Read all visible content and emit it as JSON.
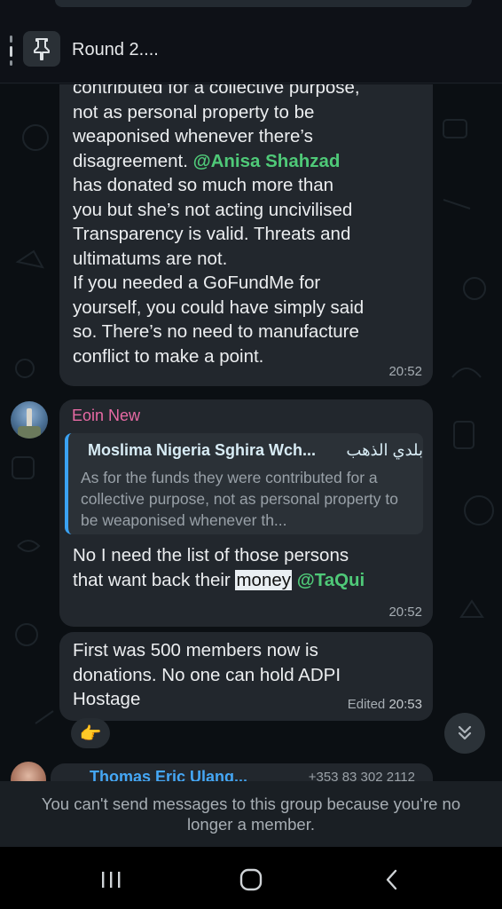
{
  "pinned": {
    "text": "Round 2...."
  },
  "messages": [
    {
      "lines": [
        "contributed for a collective purpose,",
        "not as personal property to be",
        "weaponised whenever there’s",
        "disagreement. "
      ],
      "mention": "@Anisa Shahzad",
      "rest": "\nhas donated so much more than\nyou but she’s not acting uncivilised\nTransparency is valid. Threats and\nultimatums are not.\nIf you needed a GoFundMe for\nyourself, you could have simply said\nso. There’s no need to manufacture\nconflict to make a point.",
      "time": "20:52"
    },
    {
      "sender": "Eoin New",
      "quote": {
        "name": "Moslima Nigeria Sghira Wch...",
        "name_ar": "بلدي الذهب",
        "text": "As for the funds they were contributed for a collective purpose, not as personal property to be weaponised whenever th..."
      },
      "text_before": "No I need the list of those persons\nthat want back their ",
      "highlight": "money",
      "mention": "@TaQui",
      "time": "20:52"
    },
    {
      "text": "First was 500 members now is\ndonations. No one can hold ADPI\nHostage",
      "edited_label": "Edited",
      "time": "20:53",
      "reaction": "👉"
    },
    {
      "sender": "Thomas Eric Ulang...",
      "phone": "+353 83 302 2112"
    }
  ],
  "footer": {
    "notice": "You can't send messages to this group because you're no longer a member."
  },
  "icons": {
    "pin": "pin-icon",
    "scroll_down": "double-chevron-down-icon",
    "nav_recents": "recents-icon",
    "nav_home": "home-icon",
    "nav_back": "back-icon"
  },
  "colors": {
    "mention": "#4fc978",
    "sender_eoin": "#e76aa4",
    "quote_bar": "#3aa2f3",
    "bubble": "#22272d"
  }
}
